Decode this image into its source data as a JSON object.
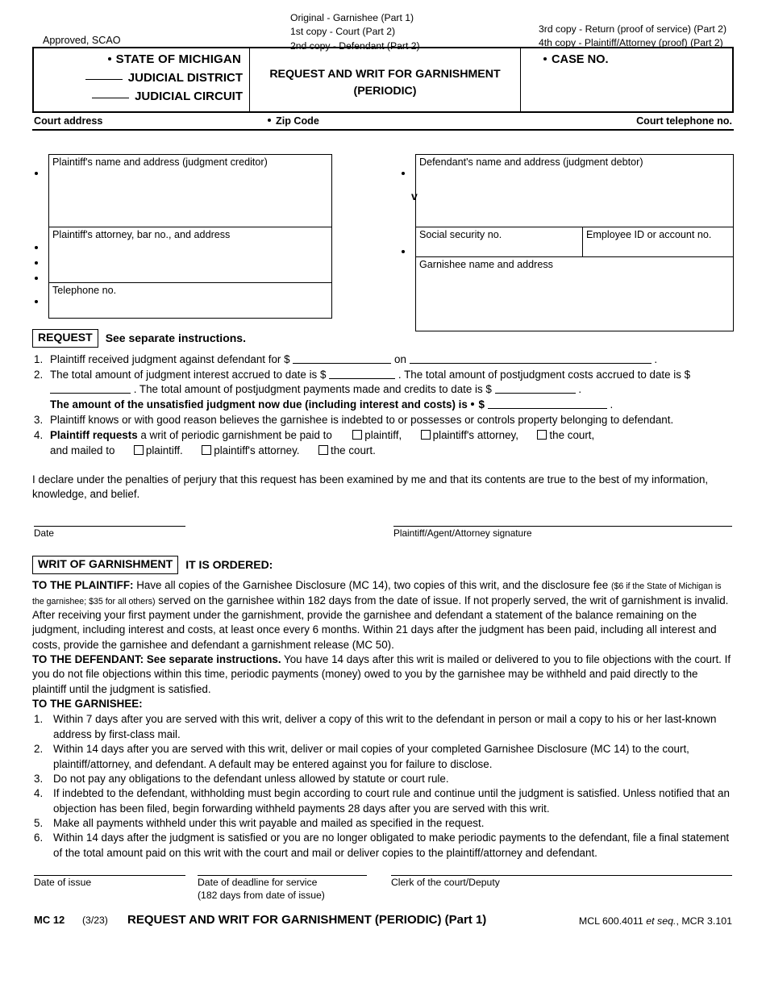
{
  "header": {
    "approved": "Approved, SCAO",
    "copies_left": [
      "Original - Garnishee (Part 1)",
      "1st copy - Court (Part 2)",
      "2nd copy - Defendant (Part 2)"
    ],
    "copies_right": [
      "3rd copy - Return (proof of service) (Part 2)",
      "4th copy - Plaintiff/Attorney (proof) (Part 2)"
    ]
  },
  "caption": {
    "state": "STATE OF MICHIGAN",
    "judicial_district": "JUDICIAL DISTRICT",
    "judicial_circuit": "JUDICIAL CIRCUIT",
    "form_title_line1": "REQUEST AND WRIT FOR GARNISHMENT",
    "form_title_line2": "(PERIODIC)",
    "case_no_label": "CASE NO."
  },
  "court_row": {
    "court_address": "Court address",
    "zip_code": "Zip Code",
    "court_telephone": "Court telephone no."
  },
  "parties": {
    "plaintiff_box": "Plaintiff's name and address (judgment creditor)",
    "plaintiff_attorney_box": "Plaintiff's attorney, bar no., and address",
    "telephone_box": "Telephone no.",
    "versus": "v",
    "defendant_box": "Defendant's name and address (judgment debtor)",
    "ssn_box": "Social security no.",
    "employee_id_box": "Employee ID or account no.",
    "garnishee_box": "Garnishee name and address"
  },
  "request": {
    "tag": "REQUEST",
    "tag_after": "See separate instructions.",
    "item1": {
      "num": "1.",
      "part_a": "Plaintiff received judgment against defendant for $",
      "part_b": "on",
      "part_c": "."
    },
    "item2": {
      "num": "2.",
      "part_a": "The total amount of judgment interest accrued to date is $",
      "part_b": ". The total amount of postjudgment costs accrued to date is $",
      "part_c": ". The total amount of postjudgment payments made and credits to date is $",
      "part_d": ".",
      "bold_line": "The amount of the unsatisfied judgment now due (including interest and costs) is",
      "bold_dollar": "$",
      "bold_end": "."
    },
    "item3": {
      "num": "3.",
      "text": "Plaintiff knows or with good reason believes the garnishee is indebted to or possesses or controls property belonging to defendant."
    },
    "item4": {
      "num": "4.",
      "bold": "Plaintiff requests",
      "text_a": "a writ of periodic garnishment be paid to",
      "opt1": "plaintiff,",
      "opt2": "plaintiff's attorney,",
      "opt3": "the court,",
      "text_b": "and mailed to",
      "opt4": "plaintiff.",
      "opt5": "plaintiff's attorney.",
      "opt6": "the court."
    }
  },
  "declaration": {
    "text": "I declare under the penalties of perjury that this request has been examined by me and that its contents are true to the best of my information, knowledge, and belief.",
    "date_label": "Date",
    "signature_label": "Plaintiff/Agent/Attorney signature"
  },
  "writ": {
    "tag": "WRIT OF GARNISHMENT",
    "tag_after": "IT IS ORDERED:",
    "to_plaintiff_label": "TO THE PLAINTIFF:",
    "to_plaintiff_a": "Have all copies of the Garnishee Disclosure (MC 14), two copies of this writ, and the disclosure fee",
    "to_plaintiff_fee": "($6 if the State of Michigan is the garnishee; $35 for all others)",
    "to_plaintiff_b": "served on the garnishee within 182 days from the date of issue. If not properly served, the writ of garnishment is invalid. After receiving your first payment under the garnishment, provide the garnishee and defendant a statement of the balance remaining on the judgment, including interest and costs, at least once every 6 months. Within 21 days after the judgment has been paid, including all interest and costs, provide the garnishee and defendant a garnishment release (MC 50).",
    "to_defendant_label": "TO THE DEFENDANT: See separate instructions.",
    "to_defendant_text": "You have 14 days after this writ is mailed or delivered to you to file objections with the court. If you do not file objections within this time, periodic payments (money) owed to you by the garnishee may be withheld and paid directly to the plaintiff until the judgment is satisfied.",
    "to_garnishee_label": "TO THE GARNISHEE:",
    "garnishee_items": [
      {
        "num": "1.",
        "text": "Within 7 days after you are served with this writ, deliver a copy of this writ to the defendant in person or mail a copy to his or her last-known address by first-class mail."
      },
      {
        "num": "2.",
        "text": "Within 14 days after you are served with this writ, deliver or mail copies of your completed Garnishee Disclosure (MC 14) to the court, plaintiff/attorney, and defendant. A default may be entered against you for failure to disclose."
      },
      {
        "num": "3.",
        "text": "Do not pay any obligations to the defendant unless allowed by statute or court rule."
      },
      {
        "num": "4.",
        "text": "If indebted to the defendant, withholding must begin according to court rule and continue until the judgment is satisfied. Unless notified that an objection has been filed, begin forwarding withheld payments 28 days after you are served with this writ."
      },
      {
        "num": "5.",
        "text": "Make all payments withheld under this writ payable and mailed as specified in the request."
      },
      {
        "num": "6.",
        "text": "Within 14 days after the judgment is satisfied or you are no longer obligated to make periodic payments to the defendant, file a final statement of the total amount paid on this writ with the court and mail or deliver copies to the plaintiff/attorney and defendant."
      }
    ]
  },
  "bottom": {
    "date_of_issue": "Date of issue",
    "deadline_label": "Date of deadline for service",
    "deadline_sub": "(182 days from date of issue)",
    "clerk_label": "Clerk of the court/Deputy"
  },
  "footer": {
    "form_no": "MC 12",
    "revision": "(3/23)",
    "title": "REQUEST AND WRIT FOR GARNISHMENT (PERIODIC) (Part 1)",
    "cite_a": "MCL 600.4011",
    "cite_italic": "et seq.",
    "cite_b": ", MCR 3.101"
  }
}
